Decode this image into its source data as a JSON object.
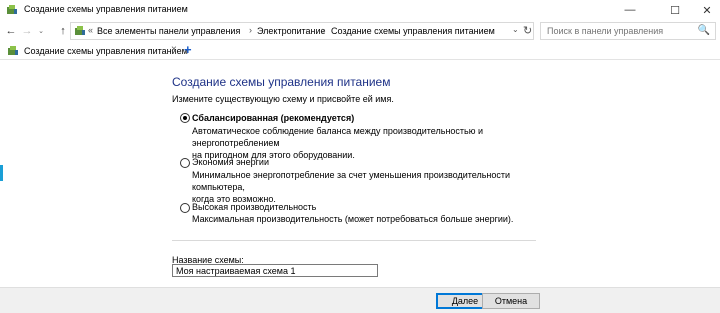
{
  "window": {
    "title": "Создание схемы управления питанием",
    "minimize_glyph": "—",
    "maximize_glyph": "☐",
    "close_glyph": "✕"
  },
  "address_bar": {
    "back_glyph": "←",
    "forward_glyph": "→",
    "history_glyph": "⌄",
    "up_glyph": "↑",
    "prefix_glyph": "«",
    "breadcrumbs": [
      "Все элементы панели управления",
      "Электропитание",
      "Создание схемы управления питанием"
    ],
    "separator": "›",
    "dropdown_glyph": "⌄",
    "refresh_glyph": "↻",
    "search_placeholder": "Поиск в панели управления",
    "search_icon": "🔍"
  },
  "tabs": [
    {
      "label": "Создание схемы управления питанием",
      "close_glyph": "×"
    }
  ],
  "tab_add_glyph": "+",
  "main": {
    "heading": "Создание схемы управления питанием",
    "subtitle": "Измените существующую схему и присвойте ей имя.",
    "options": [
      {
        "label": "Сбалансированная (рекомендуется)",
        "selected": true,
        "description_lines": [
          "Автоматическое соблюдение баланса между производительностью и энергопотреблением",
          "на пригодном для этого оборудовании."
        ]
      },
      {
        "label": "Экономия энергии",
        "selected": false,
        "description_lines": [
          "Минимальное энергопотребление за счет уменьшения производительности компьютера,",
          "когда это возможно."
        ]
      },
      {
        "label": "Высокая производительность",
        "selected": false,
        "description_lines": [
          "Максимальная производительность (может потребоваться больше энергии)."
        ]
      }
    ],
    "name_label": "Название схемы:",
    "name_value": "Моя настраиваемая схема 1"
  },
  "footer": {
    "next_label": "Далее",
    "cancel_label": "Отмена"
  },
  "colors": {
    "heading": "#1e3287",
    "accent": "#0078d7"
  }
}
